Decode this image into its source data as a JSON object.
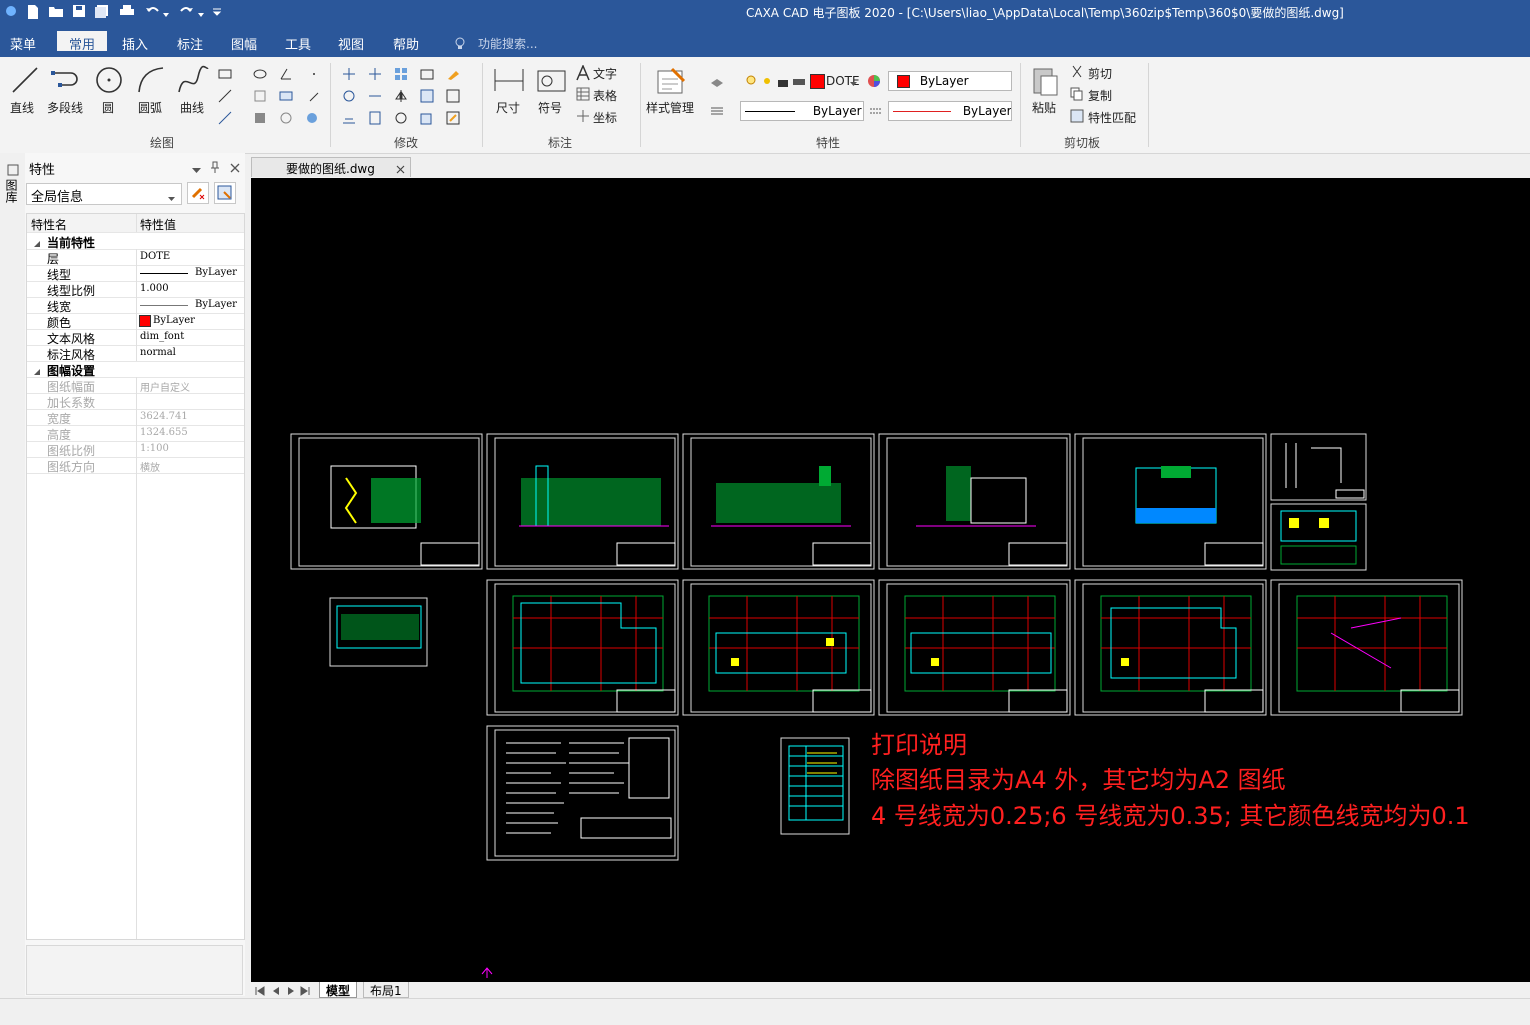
{
  "window": {
    "title": "CAXA CAD 电子图板 2020 - [C:\\Users\\liao_\\AppData\\Local\\Temp\\360zip$Temp\\360$0\\要做的图纸.dwg]"
  },
  "ribbon_tabs": [
    "菜单",
    "常用",
    "插入",
    "标注",
    "图幅",
    "工具",
    "视图",
    "帮助"
  ],
  "active_tab": "常用",
  "search_placeholder": "功能搜索...",
  "draw_group": {
    "label": "绘图",
    "tools": [
      "直线",
      "多段线",
      "圆",
      "圆弧",
      "曲线"
    ]
  },
  "modify_group": {
    "label": "修改"
  },
  "annotate_group": {
    "label": "标注",
    "tools": {
      "dimension": "尺寸",
      "symbol": "符号",
      "text": "文字",
      "table": "表格",
      "coord": "坐标"
    }
  },
  "properties_group": {
    "label": "特性",
    "style_manager": "样式管理",
    "layer_value": "DOTE",
    "color_value": "ByLayer",
    "linetype_value": "ByLayer",
    "linewidth_value": "ByLayer"
  },
  "clipboard_group": {
    "label": "剪切板",
    "paste": "粘贴",
    "cut": "剪切",
    "copy": "复制",
    "match": "特性匹配"
  },
  "side_strip_label": "图库",
  "panel": {
    "title": "特性",
    "selector": "全局信息",
    "col_name": "特性名",
    "col_value": "特性值",
    "sections": [
      {
        "name": "当前特性",
        "rows": [
          {
            "name": "层",
            "value": "DOTE"
          },
          {
            "name": "线型",
            "value": "ByLayer"
          },
          {
            "name": "线型比例",
            "value": "1.000"
          },
          {
            "name": "线宽",
            "value": "ByLayer"
          },
          {
            "name": "颜色",
            "value": "ByLayer"
          },
          {
            "name": "文本风格",
            "value": "dim_font"
          },
          {
            "name": "标注风格",
            "value": "normal"
          }
        ]
      },
      {
        "name": "图幅设置",
        "rows": [
          {
            "name": "图纸幅面",
            "value": "用户自定义"
          },
          {
            "name": "加长系数",
            "value": ""
          },
          {
            "name": "宽度",
            "value": "3624.741"
          },
          {
            "name": "高度",
            "value": "1324.655"
          },
          {
            "name": "图纸比例",
            "value": "1:100"
          },
          {
            "name": "图纸方向",
            "value": "横放"
          }
        ]
      }
    ]
  },
  "document_tab": "要做的图纸.dwg",
  "canvas_notes": [
    "打印说明",
    "除图纸目录为A4 外，其它均为A2 图纸",
    "4 号线宽为0.25;6 号线宽为0.35; 其它颜色线宽均为0.1"
  ],
  "layout_tabs": [
    "模型",
    "布局1"
  ],
  "colors": {
    "title_bar": "#2b579a",
    "canvas_bg": "#000000",
    "note_red": "#ff2020"
  }
}
